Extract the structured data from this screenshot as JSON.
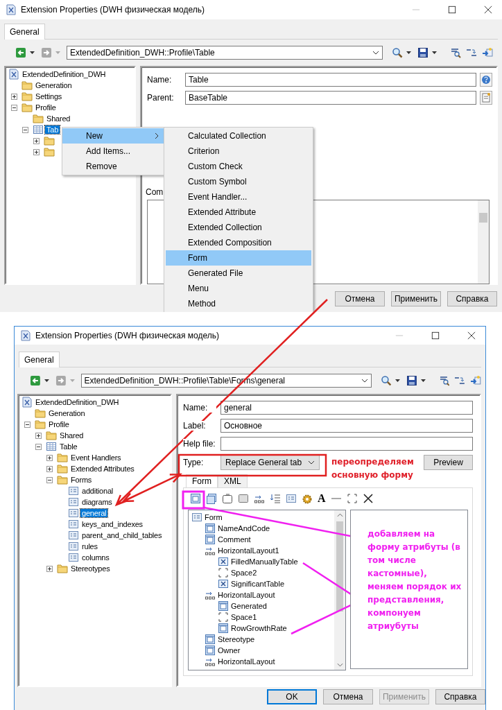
{
  "table_window": {
    "title": "Extension Properties (DWH физическая модель)",
    "tabs": [
      {
        "label": "General",
        "selected": true
      }
    ],
    "path": "ExtendedDefinition_DWH::Profile\\Table",
    "tree": [
      {
        "label": "ExtendedDefinition_DWH",
        "kind": "model",
        "selected": false,
        "children": [
          {
            "label": "Generation",
            "kind": "folder",
            "selected": false
          },
          {
            "label": "Settings",
            "kind": "folder",
            "expanded": false,
            "selected": false
          },
          {
            "label": "Profile",
            "kind": "folder",
            "expanded": true,
            "selected": false,
            "children": [
              {
                "label": "Shared",
                "kind": "folder",
                "selected": false
              },
              {
                "label": "Tab",
                "kind": "table",
                "expanded": true,
                "selected": true,
                "children": [
                  {
                    "kind": "folder",
                    "expanded": false
                  },
                  {
                    "kind": "folder",
                    "expanded": false
                  }
                ]
              }
            ]
          }
        ]
      }
    ],
    "fields": [
      {
        "label": "Name:",
        "value": "Table"
      },
      {
        "label": "Parent:",
        "value": "BaseTable"
      }
    ],
    "comment_label": "Com",
    "buttons": [
      {
        "label": "Отмена",
        "disabled": false
      },
      {
        "label": "Применить",
        "disabled": false
      },
      {
        "label": "Справка",
        "disabled": false
      }
    ],
    "context_menu": [
      {
        "label": "New",
        "selected": true,
        "submenu": true
      },
      {
        "label": "Add Items...",
        "selected": false,
        "submenu": false
      },
      {
        "label": "Remove",
        "selected": false,
        "submenu": false
      }
    ],
    "submenu": [
      {
        "label": "Calculated Collection",
        "selected": false
      },
      {
        "label": "Criterion",
        "selected": false
      },
      {
        "label": "Custom Check",
        "selected": false
      },
      {
        "label": "Custom Symbol",
        "selected": false
      },
      {
        "label": "Event Handler...",
        "selected": false
      },
      {
        "label": "Extended Attribute",
        "selected": false
      },
      {
        "label": "Extended Collection",
        "selected": false
      },
      {
        "label": "Extended Composition",
        "selected": false
      },
      {
        "label": "Form",
        "selected": true
      },
      {
        "label": "Generated File",
        "selected": false
      },
      {
        "label": "Menu",
        "selected": false
      },
      {
        "label": "Method",
        "selected": false
      }
    ]
  },
  "form_window": {
    "title": "Extension Properties (DWH физическая модель)",
    "tabs": [
      {
        "label": "General",
        "selected": true
      }
    ],
    "path": "ExtendedDefinition_DWH::Profile\\Table\\Forms\\general",
    "tree": [
      {
        "label": "ExtendedDefinition_DWH",
        "kind": "model",
        "selected": false,
        "children": [
          {
            "label": "Generation",
            "kind": "folder",
            "selected": false
          },
          {
            "label": "Profile",
            "kind": "folder",
            "expanded": true,
            "selected": false,
            "children": [
              {
                "label": "Shared",
                "kind": "folder",
                "expanded": false,
                "selected": false
              },
              {
                "label": "Table",
                "kind": "table",
                "expanded": true,
                "selected": false,
                "children": [
                  {
                    "label": "Event Handlers",
                    "kind": "folder",
                    "expanded": false,
                    "selected": false
                  },
                  {
                    "label": "Extended Attributes",
                    "kind": "folder",
                    "expanded": false,
                    "selected": false
                  },
                  {
                    "label": "Forms",
                    "kind": "folder",
                    "expanded": true,
                    "selected": false,
                    "children": [
                      {
                        "label": "additional",
                        "kind": "form",
                        "selected": false
                      },
                      {
                        "label": "diagrams",
                        "kind": "form",
                        "selected": false
                      },
                      {
                        "label": "general",
                        "kind": "form",
                        "selected": true
                      },
                      {
                        "label": "keys_and_indexes",
                        "kind": "form",
                        "selected": false
                      },
                      {
                        "label": "parent_and_child_tables",
                        "kind": "form",
                        "selected": false
                      },
                      {
                        "label": "rules",
                        "kind": "form",
                        "selected": false
                      },
                      {
                        "label": "columns",
                        "kind": "form",
                        "selected": false
                      }
                    ]
                  },
                  {
                    "label": "Stereotypes",
                    "kind": "folder",
                    "expanded": false,
                    "selected": false
                  }
                ]
              }
            ]
          }
        ]
      }
    ],
    "fields": [
      {
        "label": "Name:",
        "value": "general"
      },
      {
        "label": "Label:",
        "value": "Основное"
      },
      {
        "label": "Help file:"
      }
    ],
    "type": {
      "label": "Type:",
      "value": "Replace General tab"
    },
    "preview_button": "Preview",
    "inner_tabs": [
      {
        "label": "Form",
        "selected": true
      },
      {
        "label": "XML",
        "selected": false
      }
    ],
    "form_toolbar": [
      {
        "kind": "attribute"
      },
      {
        "kind": "attributes"
      },
      {
        "kind": "label"
      },
      {
        "kind": "group"
      },
      {
        "kind": "hlayout"
      },
      {
        "kind": "vlayout"
      },
      {
        "kind": "form"
      },
      {
        "kind": "method"
      },
      {
        "kind": "text",
        "glyph": "A"
      },
      {
        "kind": "line"
      },
      {
        "kind": "space"
      },
      {
        "kind": "delete"
      }
    ],
    "form_tree": [
      {
        "label": "Form",
        "kind": "form",
        "children": [
          {
            "label": "NameAndCode",
            "kind": "attribute"
          },
          {
            "label": "Comment",
            "kind": "attribute"
          },
          {
            "label": "HorizontalLayout1",
            "kind": "layout",
            "children": [
              {
                "label": "FilledManuallyTable",
                "kind": "checkbox"
              },
              {
                "label": "Space2",
                "kind": "space"
              },
              {
                "label": "SignificantTable",
                "kind": "checkbox"
              }
            ]
          },
          {
            "label": "HorizontalLayout",
            "kind": "layout",
            "children": [
              {
                "label": "Generated",
                "kind": "attribute"
              },
              {
                "label": "Space1",
                "kind": "space"
              },
              {
                "label": "RowGrowthRate",
                "kind": "attribute"
              }
            ]
          },
          {
            "label": "Stereotype",
            "kind": "attribute"
          },
          {
            "label": "Owner",
            "kind": "attribute"
          },
          {
            "label": "HorizontalLayout",
            "kind": "layout"
          }
        ]
      }
    ],
    "buttons": [
      {
        "label": "OK",
        "disabled": false,
        "default": true
      },
      {
        "label": "Отмена",
        "disabled": false,
        "default": false
      },
      {
        "label": "Применить",
        "disabled": true,
        "default": false
      },
      {
        "label": "Справка",
        "disabled": false,
        "default": false
      }
    ]
  },
  "annotations": {
    "type_note": "переопределяем основную форму",
    "form_note": "добавляем на форму атрибуты (в том числе кастомные), меняем порядок их представления, компонуем атриубуты"
  }
}
